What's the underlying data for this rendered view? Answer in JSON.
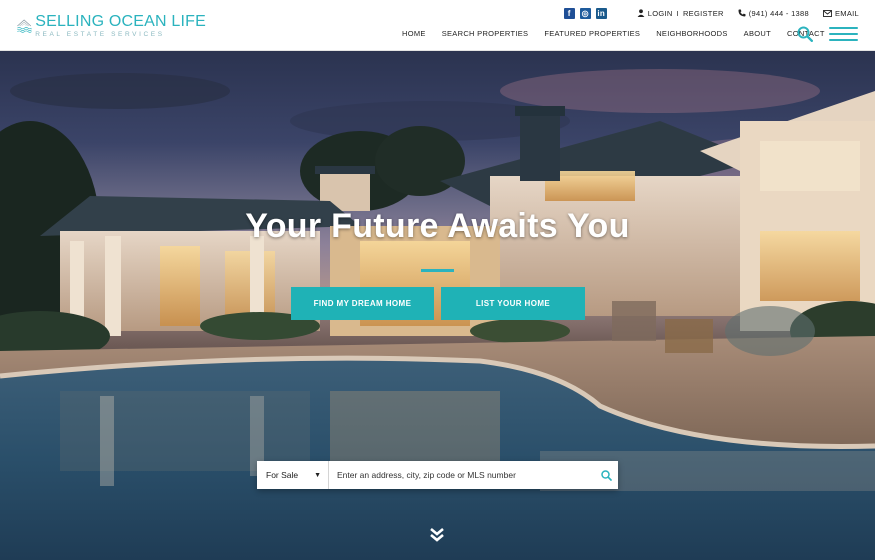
{
  "brand": {
    "name": "SELLING OCEAN LIFE",
    "tagline": "REAL ESTATE SERVICES",
    "accent": "#2bb3be"
  },
  "topbar": {
    "social": [
      {
        "name": "facebook",
        "glyph": "f"
      },
      {
        "name": "instagram",
        "glyph": "◎"
      },
      {
        "name": "linkedin",
        "glyph": "in"
      }
    ],
    "login_label": "LOGIN",
    "separator": "I",
    "register_label": "REGISTER",
    "phone": "(941) 444 - 1388",
    "email_label": "EMAIL"
  },
  "nav": {
    "items": [
      "HOME",
      "SEARCH PROPERTIES",
      "FEATURED PROPERTIES",
      "NEIGHBORHOODS",
      "ABOUT",
      "CONTACT"
    ]
  },
  "hero": {
    "title": "Your Future Awaits You",
    "cta_primary": "FIND MY DREAM HOME",
    "cta_secondary": "LIST YOUR HOME",
    "button_color": "#1fb2b6"
  },
  "search": {
    "selected": "For Sale",
    "placeholder": "Enter an address, city, zip code or MLS number"
  }
}
